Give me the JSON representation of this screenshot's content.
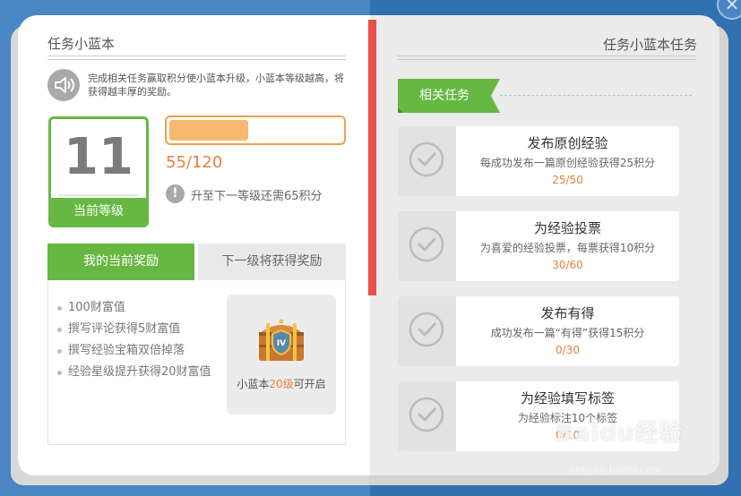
{
  "left": {
    "title": "任务小蓝本",
    "description": "完成相关任务赢取积分使小蓝本升级，小蓝本等级越高，将获得越丰厚的奖励。",
    "level": {
      "number": "11",
      "label": "当前等级"
    },
    "progress": {
      "text": "55/120",
      "fraction": 0.458
    },
    "next_level_hint": "升至下一等级还需65积分",
    "tabs": [
      "我的当前奖励",
      "下一级将获得奖励"
    ],
    "rewards": [
      "100财富值",
      "撰写评论获得5财富值",
      "撰写经验宝箱双倍掉落",
      "经验星级提升获得20财富值"
    ],
    "chest": {
      "badge": "IV",
      "caption_pre": "小蓝本",
      "caption_hl": "20级",
      "caption_post": "可开启"
    }
  },
  "right": {
    "title": "任务小蓝本任务",
    "section_label": "相关任务",
    "tasks": [
      {
        "title": "发布原创经验",
        "desc": "每成功发布一篇原创经验获得25积分",
        "progress": "25/50"
      },
      {
        "title": "为经验投票",
        "desc": "为喜爱的经验投票，每票获得10积分",
        "progress": "30/60"
      },
      {
        "title": "发布有得",
        "desc": "成功发布一篇“有得”获得15积分",
        "progress": "0/30"
      },
      {
        "title": "为经验填写标签",
        "desc": "为经验标注10个标签",
        "progress": "0/10"
      }
    ]
  },
  "watermark": {
    "brand": "Baidu经验",
    "url": "jingyan.baidu.com"
  },
  "icons": {
    "speaker": "speaker-icon",
    "warning": "exclamation-icon",
    "check": "check-circle-icon",
    "close": "close-icon",
    "chest": "treasure-chest-icon"
  },
  "colors": {
    "green": "#67b843",
    "orange": "#e8813d",
    "red_spine": "#e8504a",
    "blue_bg": "#3a78b7"
  }
}
